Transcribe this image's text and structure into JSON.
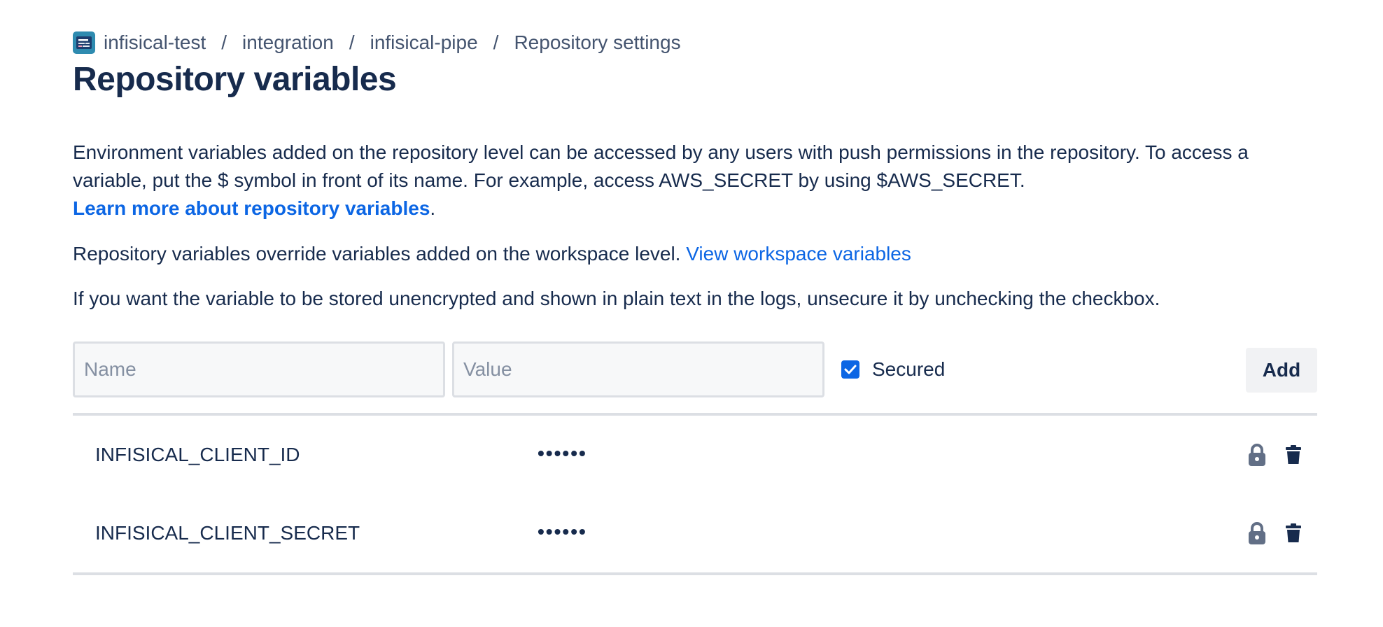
{
  "breadcrumb": {
    "workspace": "infisical-test",
    "project": "integration",
    "repository": "infisical-pipe",
    "current": "Repository settings",
    "separator": "/"
  },
  "page": {
    "title": "Repository variables"
  },
  "description": {
    "paragraph1_text": "Environment variables added on the repository level can be accessed by any users with push permissions in the repository. To access a variable, put the $ symbol in front of its name. For example, access AWS_SECRET by using $AWS_SECRET.",
    "learn_more_link": "Learn more about repository variables",
    "learn_more_suffix": ".",
    "paragraph2_text": "Repository variables override variables added on the workspace level. ",
    "workspace_link": "View workspace variables",
    "paragraph3_text": "If you want the variable to be stored unencrypted and shown in plain text in the logs, unsecure it by unchecking the checkbox."
  },
  "form": {
    "name_placeholder": "Name",
    "name_value": "",
    "value_placeholder": "Value",
    "value_value": "",
    "secured_label": "Secured",
    "secured_checked": true,
    "add_label": "Add"
  },
  "variables": [
    {
      "name": "INFISICAL_CLIENT_ID",
      "value": "••••••",
      "secured": true
    },
    {
      "name": "INFISICAL_CLIENT_SECRET",
      "value": "••••••",
      "secured": true
    }
  ],
  "icons": {
    "repo_avatar": "repository-avatar-icon",
    "checkbox": "checkmark-icon",
    "lock": "lock-icon",
    "delete": "trash-icon"
  },
  "colors": {
    "text": "#172b4d",
    "subtle_text": "#44546f",
    "link": "#0c66e4",
    "checkbox": "#0c66e4",
    "icon": "#626f86",
    "divider": "#dcdfe4"
  }
}
